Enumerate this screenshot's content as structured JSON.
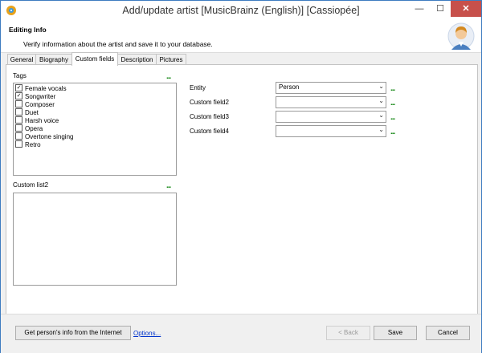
{
  "window": {
    "title": "Add/update artist [MusicBrainz (English)] [Cassiopée]",
    "minimize": "—",
    "maximize": "☐",
    "close": "✕"
  },
  "header": {
    "title": "Editing Info",
    "description": "Verify information about the artist and save it to your database."
  },
  "tabs": [
    {
      "label": "General"
    },
    {
      "label": "Biography"
    },
    {
      "label": "Custom fields",
      "active": true
    },
    {
      "label": "Description"
    },
    {
      "label": "Pictures"
    }
  ],
  "tags": {
    "label": "Tags",
    "more": "...",
    "items": [
      {
        "label": "Female vocals",
        "checked": true,
        "mark": "✓"
      },
      {
        "label": "Songwriter",
        "checked": true,
        "mark": "✓"
      },
      {
        "label": "Composer",
        "checked": false,
        "mark": ""
      },
      {
        "label": "Duet",
        "checked": false,
        "mark": ""
      },
      {
        "label": "Harsh voice",
        "checked": false,
        "mark": ""
      },
      {
        "label": "Opera",
        "checked": false,
        "mark": ""
      },
      {
        "label": "Overtone singing",
        "checked": false,
        "mark": ""
      },
      {
        "label": "Retro",
        "checked": false,
        "mark": ""
      }
    ]
  },
  "custom_list2": {
    "label": "Custom list2",
    "more": "..."
  },
  "fields": [
    {
      "label": "Entity",
      "value": "Person",
      "more": "...",
      "arrow": "⌄"
    },
    {
      "label": "Custom field2",
      "value": "",
      "more": "...",
      "arrow": "⌄"
    },
    {
      "label": "Custom field3",
      "value": "",
      "more": "...",
      "arrow": "⌄"
    },
    {
      "label": "Custom field4",
      "value": "",
      "more": "...",
      "arrow": "⌄"
    }
  ],
  "buttons": {
    "get_info": "Get person's info from the Internet",
    "options": "Options...",
    "back": "< Back",
    "save": "Save",
    "cancel": "Cancel"
  },
  "colors": {
    "accent": "#3e7cc0",
    "close": "#c7504b",
    "dots": "#1a8a1a",
    "link": "#0033cc"
  }
}
